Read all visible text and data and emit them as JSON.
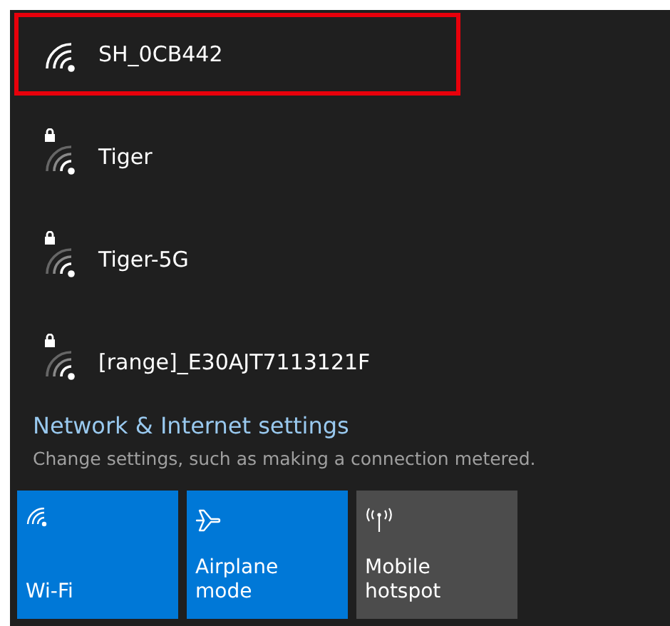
{
  "networks": [
    {
      "name": "SH_0CB442",
      "secured": false,
      "highlighted": true
    },
    {
      "name": "Tiger",
      "secured": true,
      "highlighted": false
    },
    {
      "name": "Tiger-5G",
      "secured": true,
      "highlighted": false
    },
    {
      "name": "[range]_E30AJT7113121F",
      "secured": true,
      "highlighted": false
    }
  ],
  "settings_link": "Network & Internet settings",
  "settings_hint": "Change settings, such as making a connection metered.",
  "tiles": [
    {
      "kind": "wifi",
      "label": "Wi-Fi",
      "on": true
    },
    {
      "kind": "airplane",
      "label": "Airplane mode",
      "on": true
    },
    {
      "kind": "hotspot",
      "label": "Mobile hotspot",
      "on": false
    }
  ]
}
